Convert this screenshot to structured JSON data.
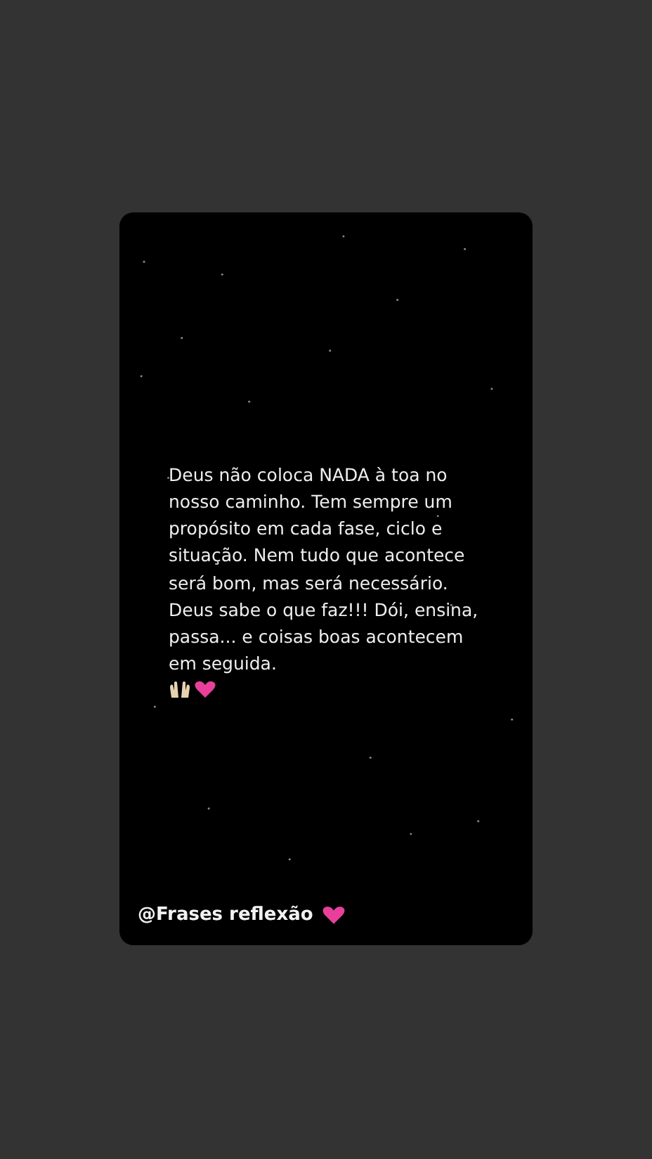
{
  "post": {
    "quote": "Deus não coloca NADA à toa no nosso caminho. Tem sempre um propósito em cada fase, ciclo e situação. Nem tudo que acontece será bom, mas será necessário. Deus sabe o que faz!!! Dói, ensina, passa... e coisas boas acontecem em seguida.",
    "author": "@Frases reflexão"
  }
}
